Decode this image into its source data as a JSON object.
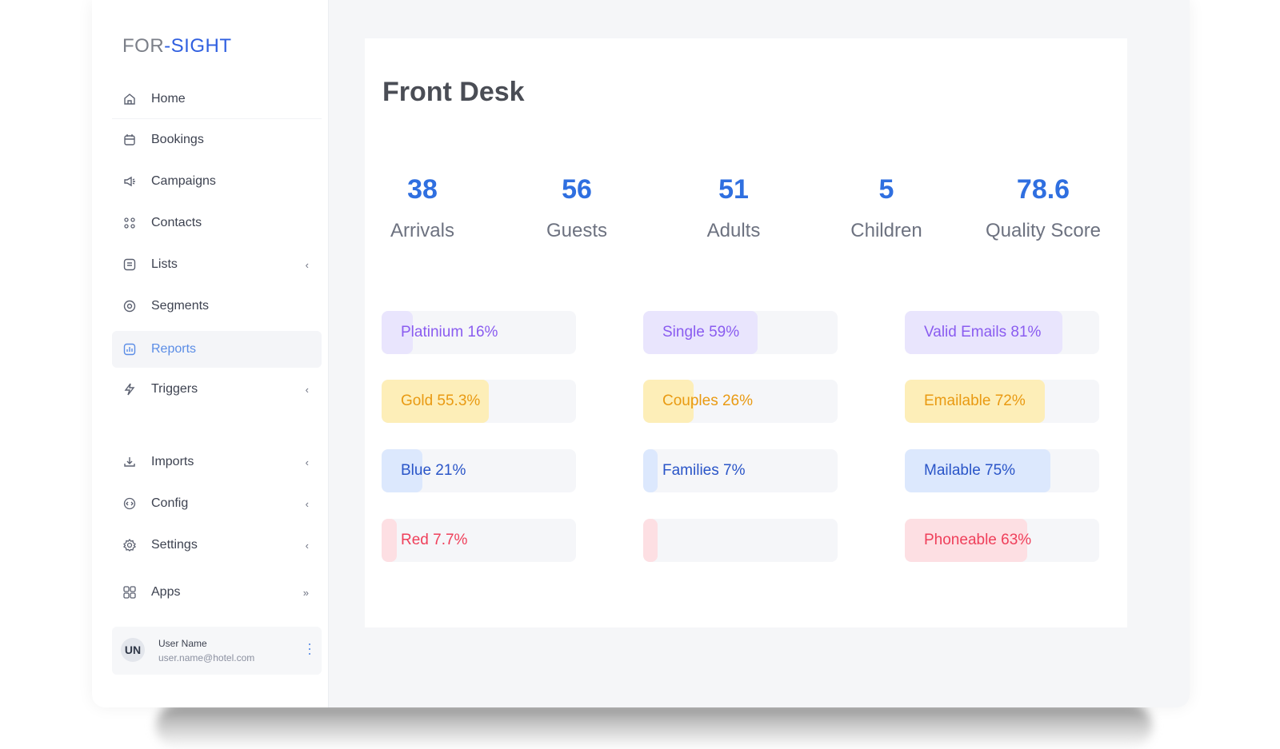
{
  "brand": {
    "part1": "FOR",
    "dash": "-",
    "part2": "SIGHT"
  },
  "sidebar": {
    "items": [
      {
        "label": "Home",
        "icon": "home-icon"
      },
      {
        "label": "Bookings",
        "icon": "calendar-icon"
      },
      {
        "label": "Campaigns",
        "icon": "megaphone-icon"
      },
      {
        "label": "Contacts",
        "icon": "contacts-icon"
      },
      {
        "label": "Lists",
        "icon": "list-icon",
        "chevron": "‹"
      },
      {
        "label": "Segments",
        "icon": "segments-icon"
      },
      {
        "label": "Reports",
        "icon": "reports-icon",
        "active": true
      },
      {
        "label": "Triggers",
        "icon": "lightning-icon",
        "chevron": "‹"
      },
      {
        "label": "Imports",
        "icon": "download-icon",
        "chevron": "‹"
      },
      {
        "label": "Config",
        "icon": "code-icon",
        "chevron": "‹"
      },
      {
        "label": "Settings",
        "icon": "gear-icon",
        "chevron": "‹"
      },
      {
        "label": "Apps",
        "icon": "apps-grid-icon",
        "chevron": "»"
      }
    ]
  },
  "user": {
    "initials": "UN",
    "name": "User Name",
    "email": "user.name@hotel.com"
  },
  "main": {
    "title": "Front Desk",
    "stats": [
      {
        "value": "38",
        "label": "Arrivals"
      },
      {
        "value": "56",
        "label": "Guests"
      },
      {
        "value": "51",
        "label": "Adults"
      },
      {
        "value": "5",
        "label": "Children"
      },
      {
        "value": "78.6",
        "label": "Quality Score"
      }
    ],
    "bars": [
      [
        {
          "label": "Platinium 16%",
          "pct": 0.16,
          "fill": "#e9e5fd",
          "text": "#8a5cf0"
        },
        {
          "label": "Gold 55.3%",
          "pct": 0.553,
          "fill": "#fdeeb8",
          "text": "#e99a12"
        },
        {
          "label": "Blue 21%",
          "pct": 0.21,
          "fill": "#dce8fd",
          "text": "#2a55c8"
        },
        {
          "label": "Red 7.7%",
          "pct": 0.077,
          "fill": "#fddfe3",
          "text": "#ef3f5a"
        }
      ],
      [
        {
          "label": "Single 59%",
          "pct": 0.59,
          "fill": "#e9e5fd",
          "text": "#8a5cf0"
        },
        {
          "label": "Couples 26%",
          "pct": 0.26,
          "fill": "#fdeeb8",
          "text": "#e99a12"
        },
        {
          "label": "Families 7%",
          "pct": 0.07,
          "fill": "#dce8fd",
          "text": "#2a55c8"
        },
        {
          "label": "",
          "pct": 0.03,
          "fill": "#fddfe3",
          "text": "#ef3f5a"
        }
      ],
      [
        {
          "label": "Valid Emails 81%",
          "pct": 0.81,
          "fill": "#e9e5fd",
          "text": "#8a5cf0"
        },
        {
          "label": "Emailable 72%",
          "pct": 0.72,
          "fill": "#fdeeb8",
          "text": "#e99a12"
        },
        {
          "label": "Mailable 75%",
          "pct": 0.75,
          "fill": "#dce8fd",
          "text": "#2a55c8"
        },
        {
          "label": "Phoneable 63%",
          "pct": 0.63,
          "fill": "#fddfe3",
          "text": "#ef3f5a"
        }
      ]
    ]
  }
}
